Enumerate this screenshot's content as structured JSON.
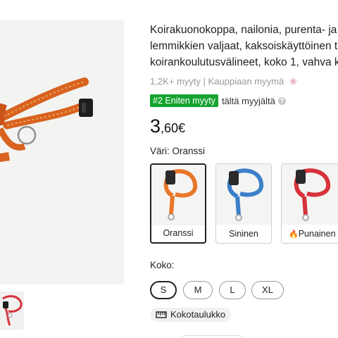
{
  "product": {
    "title_lines": [
      "Koirakuonokoppa, nailonia, purenta- ja h",
      "lemmikkien valjaat, kaksoiskäyttöinen tal",
      "koirankoulutusvälineet, koko 1, vahva ka"
    ],
    "sold": "1,2K+ myyty",
    "separator": "|",
    "store_status": "Kauppiaan myymä",
    "rank_badge": "#2 Eniten myyty",
    "rank_suffix": "tältä myyjältä",
    "price_integer": "3",
    "price_decimal": ",60€"
  },
  "color_section": {
    "label": "Väri: Oranssi",
    "options": [
      {
        "name": "Oranssi",
        "selected": true,
        "color": "#e8772a"
      },
      {
        "name": "Sininen",
        "selected": false,
        "color": "#3b7fc8"
      },
      {
        "name": "Punainen",
        "selected": false,
        "color": "#d6323a",
        "hot": true
      }
    ]
  },
  "size_section": {
    "label": "Koko:",
    "options": [
      {
        "name": "S",
        "selected": true
      },
      {
        "name": "M",
        "selected": false
      },
      {
        "name": "L",
        "selected": false
      },
      {
        "name": "XL",
        "selected": false
      }
    ]
  },
  "size_chart_button": "Kokotaulukko",
  "icons": {
    "flower": "flower-icon",
    "info": "info-icon",
    "flame": "flame-icon",
    "ruler": "ruler-icon"
  },
  "colors": {
    "badge_green": "#14a330",
    "orange": "#e8772a",
    "blue": "#3b7fc8",
    "red": "#d6323a"
  }
}
